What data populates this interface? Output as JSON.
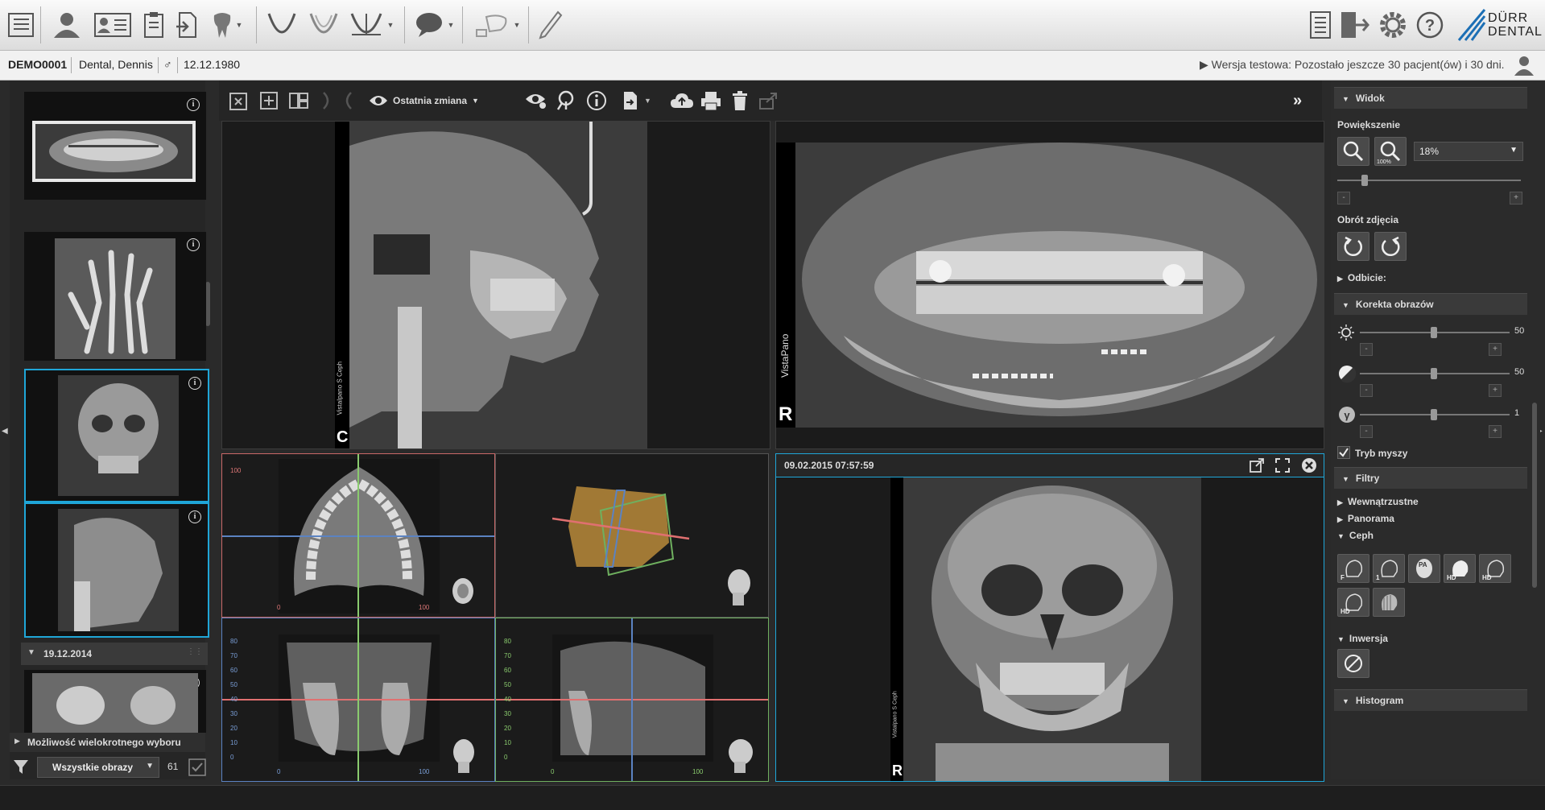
{
  "toolbar": {
    "brand_line1": "DÜRR",
    "brand_line2": "DENTAL"
  },
  "patient": {
    "id": "DEMO0001",
    "name": "Dental, Dennis",
    "sex_symbol": "♂",
    "dob": "12.12.1980",
    "trial_notice": "▶ Wersja testowa: Pozostało jeszcze 30 pacjent(ów) i 30 dni."
  },
  "left_panel": {
    "group_date": "19.12.2014",
    "multi_select_label": "Możliwość wielokrotnego wyboru",
    "filter_value": "Wszystkie obrazy",
    "count": "61"
  },
  "main_toolbar": {
    "last_change_label": "Ostatnia zmiana",
    "more_icon": "double-chevron-right"
  },
  "viewports": {
    "ceph_letter": "C",
    "ceph_vertical_text": "VistaIpano S Ceph",
    "pano_letter": "R",
    "pano_vertical_text": "VistaPano",
    "pa_header": "09.02.2015 07:57:59",
    "pa_letter": "R",
    "pa_vertical_text": "VistaIpano S Ceph",
    "axial_ticks": [
      "100",
      "0",
      "100"
    ],
    "coronal_yticks": [
      "80",
      "70",
      "60",
      "50",
      "40",
      "30",
      "20",
      "10",
      "0"
    ],
    "coronal_xticks": [
      "0",
      "100"
    ],
    "sagittal_yticks": [
      "80",
      "70",
      "60",
      "50",
      "40",
      "30",
      "20",
      "10",
      "0"
    ],
    "sagittal_xticks": [
      "0",
      "100"
    ]
  },
  "right_panel": {
    "widok": "Widok",
    "powiekszenie": "Powiększenie",
    "zoom_value": "18%",
    "obrot": "Obrót zdjęcia",
    "odbicie": "Odbicie:",
    "korekta": "Korekta obrazów",
    "brightness_value": "50",
    "contrast_value": "50",
    "gamma_value": "1",
    "tryb_myszy": "Tryb myszy",
    "filtry": "Filtry",
    "wewnatrzustne": "Wewnątrzustne",
    "panorama": "Panorama",
    "ceph": "Ceph",
    "inwersja": "Inwersja",
    "histogram": "Histogram",
    "zoom_100": "100%",
    "ceph_filter_labels": [
      "F",
      "1",
      "PA",
      "HD",
      "HD",
      "HD",
      ""
    ]
  },
  "colors": {
    "accent": "#1fa6d8",
    "axial_border": "#c96868",
    "coronal_border": "#5b83c2",
    "sagittal_border": "#6fb05f"
  }
}
